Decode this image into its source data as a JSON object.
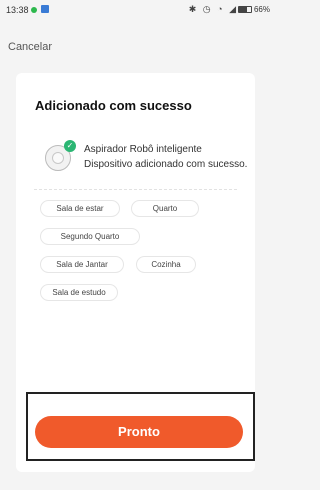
{
  "status_bar": {
    "time": "13:38",
    "icons": "✱ ◷ ◔ ◢",
    "battery": "66%"
  },
  "nav": {
    "cancel": "Cancelar"
  },
  "card": {
    "title": "Adicionado com sucesso",
    "device": {
      "name": "Aspirador Robô inteligente",
      "status": "Dispositivo adicionado com sucesso."
    },
    "rooms": [
      "Sala de estar",
      "Quarto",
      "Segundo Quarto",
      "Sala de Jantar",
      "Cozinha",
      "Sala de estudo"
    ]
  },
  "actions": {
    "done": "Pronto"
  },
  "colors": {
    "accent": "#f05a2b",
    "success": "#2bb673"
  }
}
